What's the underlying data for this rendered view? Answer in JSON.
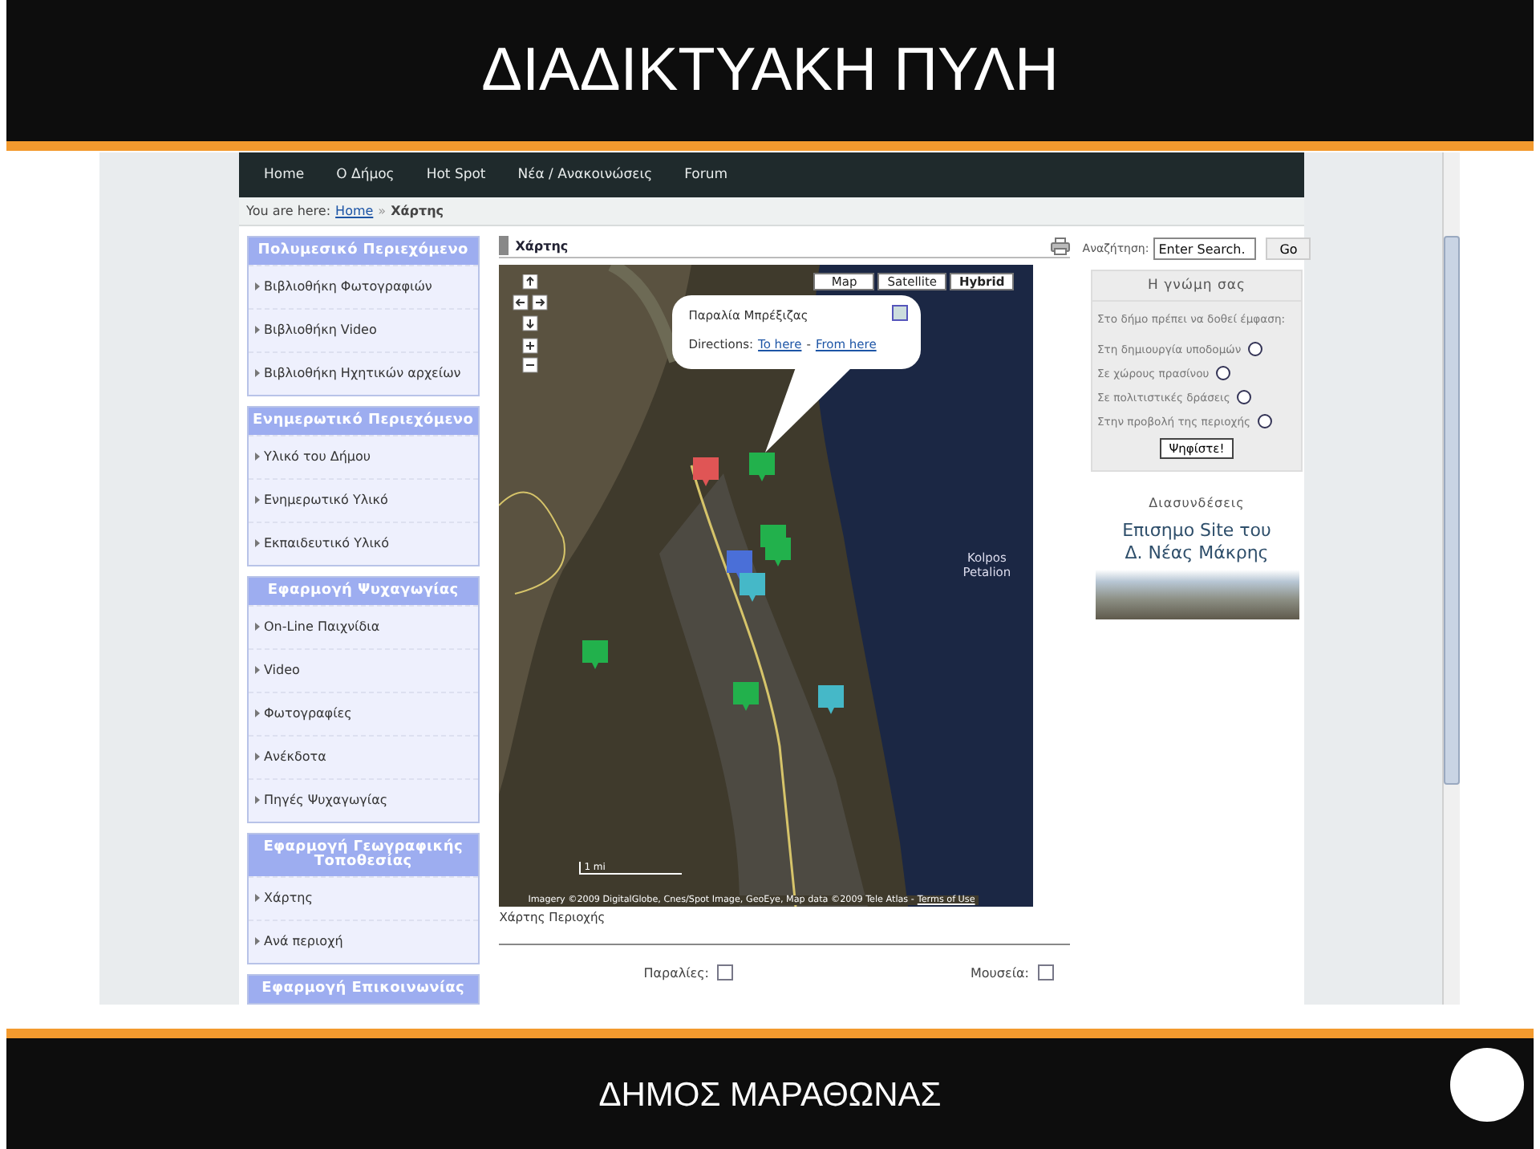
{
  "slide_title": "ΔΙΑΔΙΚΤΥΑΚΗ ΠΥΛΗ",
  "nav": [
    "Home",
    "Ο Δήμος",
    "Hot Spot",
    "Νέα / Ανακοινώσεις",
    "Forum"
  ],
  "breadcrumb": {
    "prefix": "You are here:",
    "link": "Home",
    "separator": "»",
    "current": "Χάρτης"
  },
  "sidebar": [
    {
      "title": "Πολυμεσικό Περιεχόμενο",
      "items": [
        "Βιβλιοθήκη Φωτογραφιών",
        "Βιβλιοθήκη Video",
        "Βιβλιοθήκη Ηχητικών αρχείων"
      ]
    },
    {
      "title": "Ενημερωτικό Περιεχόμενο",
      "items": [
        "Υλικό του Δήμου",
        "Ενημερωτικό Υλικό",
        "Εκπαιδευτικό Υλικό"
      ]
    },
    {
      "title": "Εφαρμογή Ψυχαγωγίας",
      "items": [
        "On-Line Παιχνίδια",
        "Video",
        "Φωτογραφίες",
        "Ανέκδοτα",
        "Πηγές Ψυχαγωγίας"
      ]
    },
    {
      "title": "Εφαρμογή Γεωγραφικής Τοποθεσίας",
      "items": [
        "Χάρτης",
        "Ανά περιοχή"
      ]
    },
    {
      "title": "Εφαρμογή Επικοινωνίας"
    }
  ],
  "main": {
    "title": "Χάρτης",
    "map": {
      "types": [
        {
          "label": "Map",
          "selected": false
        },
        {
          "label": "Satellite",
          "selected": false
        },
        {
          "label": "Hybrid",
          "selected": true
        }
      ],
      "popup": {
        "title": "Παραλία Μπρέξιζας",
        "directions_label": "Directions:",
        "links": [
          "To here",
          "From here"
        ],
        "separator": "-"
      },
      "sea_label": "Kolpos Petalion",
      "scale": "1 mi",
      "attribution": "Imagery ©2009 DigitalGlobe, Cnes/Spot Image, GeoEye, Map data ©2009 Tele Atlas -",
      "terms": "Terms of Use",
      "markers": [
        {
          "color": "#e05555"
        },
        {
          "color": "#22b14c"
        },
        {
          "color": "#22b14c"
        },
        {
          "color": "#22b14c"
        },
        {
          "color": "#4a6fd8"
        },
        {
          "color": "#45b8c8"
        },
        {
          "color": "#22b14c"
        },
        {
          "color": "#22b14c"
        },
        {
          "color": "#45b8c8"
        }
      ]
    },
    "caption": "Χάρτης Περιοχής",
    "filters": [
      {
        "label": "Παραλίες:",
        "checked": false
      },
      {
        "label": "Μουσεία:",
        "checked": false
      }
    ]
  },
  "search": {
    "label": "Αναζήτηση:",
    "placeholder": "Enter Search.",
    "button": "Go"
  },
  "poll": {
    "title": "Η γνώμη σας",
    "question": "Στο δήμο πρέπει να δοθεί έμφαση:",
    "options": [
      {
        "label": "Στη δημιουργία υποδομών",
        "selected": false
      },
      {
        "label": "Σε χώρους πρασίνου",
        "selected": false
      },
      {
        "label": "Σε πολιτιστικές δράσεις",
        "selected": false
      },
      {
        "label": "Στην προβολή της περιοχής",
        "selected": false
      }
    ],
    "button": "Ψηφίστε!"
  },
  "links": {
    "title": "Διασυνδέσεις",
    "banner": [
      "Επισημο Site του",
      "Δ. Νέας Μάκρης"
    ]
  },
  "footer": "ΔΗΜΟΣ ΜΑΡΑΘΩΝΑΣ"
}
